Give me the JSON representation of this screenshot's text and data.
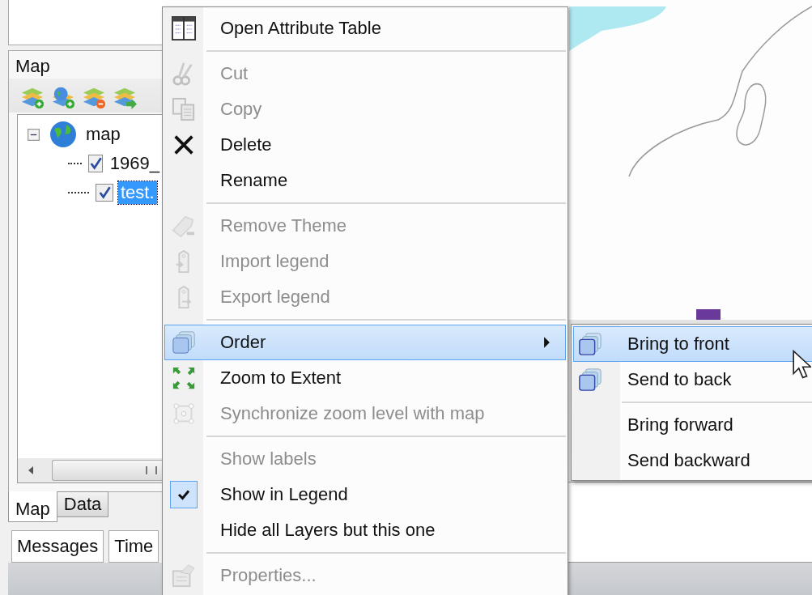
{
  "layers_panel": {
    "title": "Map",
    "tree": {
      "label": "map",
      "expanded": true,
      "children": [
        {
          "label": "1969_",
          "checked": true,
          "selected": false
        },
        {
          "label": "test.",
          "checked": true,
          "selected": true
        }
      ]
    },
    "tabs": [
      {
        "label": "Map",
        "selected": true
      },
      {
        "label": "Data",
        "selected": false
      }
    ]
  },
  "bottom_tabs": [
    {
      "label": "Messages"
    },
    {
      "label": "Time"
    }
  ],
  "context_menu": {
    "items": [
      {
        "kind": "item",
        "label": "Open Attribute Table",
        "disabled": false,
        "selected": false,
        "checked": false,
        "submenu": false
      },
      {
        "kind": "separator"
      },
      {
        "kind": "item",
        "label": "Cut",
        "disabled": true,
        "selected": false,
        "checked": false,
        "submenu": false
      },
      {
        "kind": "item",
        "label": "Copy",
        "disabled": true,
        "selected": false,
        "checked": false,
        "submenu": false
      },
      {
        "kind": "item",
        "label": "Delete",
        "disabled": false,
        "selected": false,
        "checked": false,
        "submenu": false
      },
      {
        "kind": "item",
        "label": "Rename",
        "disabled": false,
        "selected": false,
        "checked": false,
        "submenu": false
      },
      {
        "kind": "separator"
      },
      {
        "kind": "item",
        "label": "Remove Theme",
        "disabled": true,
        "selected": false,
        "checked": false,
        "submenu": false
      },
      {
        "kind": "item",
        "label": "Import legend",
        "disabled": true,
        "selected": false,
        "checked": false,
        "submenu": false
      },
      {
        "kind": "item",
        "label": "Export legend",
        "disabled": true,
        "selected": false,
        "checked": false,
        "submenu": false
      },
      {
        "kind": "separator"
      },
      {
        "kind": "item",
        "label": "Order",
        "disabled": false,
        "selected": true,
        "checked": false,
        "submenu": true
      },
      {
        "kind": "item",
        "label": "Zoom to Extent",
        "disabled": false,
        "selected": false,
        "checked": false,
        "submenu": false
      },
      {
        "kind": "item",
        "label": "Synchronize zoom level with map",
        "disabled": true,
        "selected": false,
        "checked": false,
        "submenu": false
      },
      {
        "kind": "separator"
      },
      {
        "kind": "item",
        "label": "Show labels",
        "disabled": true,
        "selected": false,
        "checked": false,
        "submenu": false
      },
      {
        "kind": "item",
        "label": "Show in Legend",
        "disabled": false,
        "selected": false,
        "checked": true,
        "submenu": false
      },
      {
        "kind": "item",
        "label": "Hide all Layers but this one",
        "disabled": false,
        "selected": false,
        "checked": false,
        "submenu": false
      },
      {
        "kind": "separator"
      },
      {
        "kind": "item",
        "label": "Properties...",
        "disabled": true,
        "selected": false,
        "checked": false,
        "submenu": false
      }
    ]
  },
  "order_submenu": {
    "items": [
      {
        "kind": "item",
        "label": "Bring to front",
        "selected": true
      },
      {
        "kind": "item",
        "label": "Send to back",
        "selected": false
      },
      {
        "kind": "separator"
      },
      {
        "kind": "item",
        "label": "Bring forward",
        "selected": false
      },
      {
        "kind": "item",
        "label": "Send backward",
        "selected": false
      }
    ]
  }
}
